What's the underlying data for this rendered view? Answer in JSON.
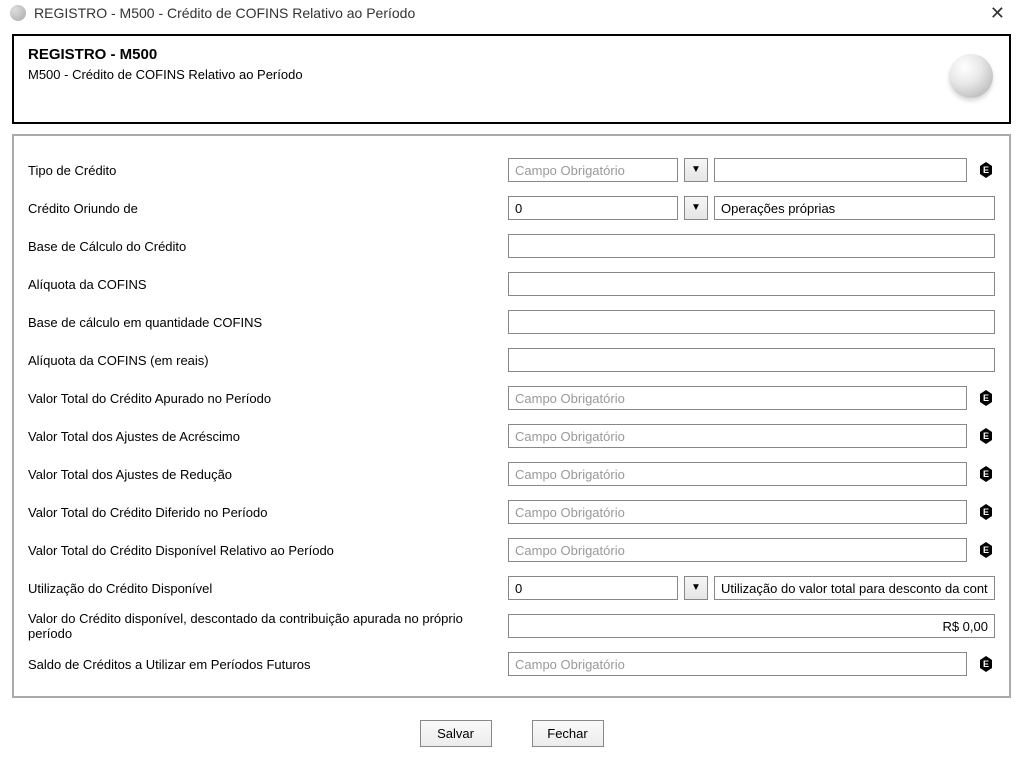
{
  "window": {
    "title": "REGISTRO - M500 - Crédito de COFINS Relativo ao Período"
  },
  "header": {
    "title": "REGISTRO - M500",
    "subtitle": "M500 - Crédito de COFINS Relativo ao Período"
  },
  "placeholder_required": "Campo Obrigatório",
  "fields": {
    "tipo_credito": {
      "label": "Tipo de Crédito",
      "value": "",
      "placeholder": "Campo Obrigatório",
      "desc": ""
    },
    "credito_oriundo": {
      "label": "Crédito Oriundo de",
      "value": "0",
      "desc": "Operações próprias"
    },
    "base_calculo_credito": {
      "label": "Base de Cálculo do Crédito",
      "value": ""
    },
    "aliquota_cofins": {
      "label": "Alíquota da COFINS",
      "value": ""
    },
    "base_calculo_qtd_cofins": {
      "label": "Base de cálculo em quantidade COFINS",
      "value": ""
    },
    "aliquota_cofins_reais": {
      "label": "Alíquota da COFINS (em reais)",
      "value": ""
    },
    "valor_total_credito_apurado": {
      "label": "Valor Total do Crédito Apurado no Período",
      "placeholder": "Campo Obrigatório",
      "value": ""
    },
    "valor_total_ajustes_acrescimo": {
      "label": "Valor Total dos Ajustes de Acréscimo",
      "placeholder": "Campo Obrigatório",
      "value": ""
    },
    "valor_total_ajustes_reducao": {
      "label": "Valor Total dos Ajustes de Redução",
      "placeholder": "Campo Obrigatório",
      "value": ""
    },
    "valor_total_credito_diferido": {
      "label": "Valor Total do Crédito Diferido no Período",
      "placeholder": "Campo Obrigatório",
      "value": ""
    },
    "valor_total_credito_disponivel": {
      "label": "Valor Total do Crédito Disponível Relativo ao Período",
      "placeholder": "Campo Obrigatório",
      "value": ""
    },
    "utilizacao_credito_disponivel": {
      "label": "Utilização do Crédito Disponível",
      "value": "0",
      "desc": "Utilização do valor total para desconto da contribuiçã"
    },
    "valor_credito_descontado": {
      "label": "Valor do Crédito disponível, descontado da contribuição apurada no próprio período",
      "value": "R$ 0,00"
    },
    "saldo_creditos_futuros": {
      "label": "Saldo de Créditos a Utilizar em Períodos Futuros",
      "placeholder": "Campo Obrigatório",
      "value": ""
    }
  },
  "buttons": {
    "save": "Salvar",
    "close": "Fechar"
  }
}
